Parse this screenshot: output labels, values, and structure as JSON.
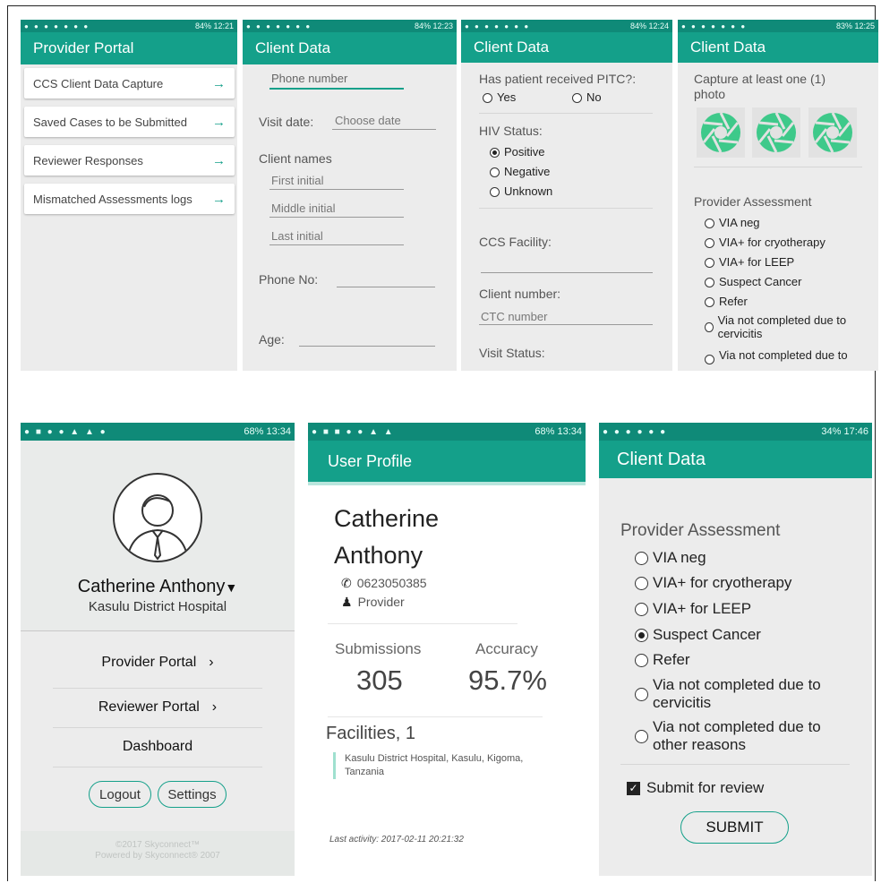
{
  "screen1": {
    "status": "84% 12:21",
    "title": "Provider Portal",
    "items": [
      "CCS Client Data Capture",
      "Saved Cases to be Submitted",
      "Reviewer Responses",
      "Mismatched Assessments logs"
    ]
  },
  "screen2": {
    "status": "84% 12:23",
    "title": "Client Data",
    "phone_placeholder": "Phone number",
    "visit_date_label": "Visit date:",
    "visit_date_placeholder": "Choose date",
    "client_names_label": "Client names",
    "first_initial": "First initial",
    "middle_initial": "Middle initial",
    "last_initial": "Last initial",
    "phone_no_label": "Phone No:",
    "age_label": "Age:"
  },
  "screen3": {
    "status": "84% 12:24",
    "title": "Client Data",
    "pitc_label": "Has patient received PITC?:",
    "yes": "Yes",
    "no": "No",
    "hiv_label": "HIV Status:",
    "hiv_options": [
      "Positive",
      "Negative",
      "Unknown"
    ],
    "hiv_selected": 0,
    "facility_label": "CCS Facility:",
    "client_number_label": "Client number:",
    "ctc_placeholder": "CTC number",
    "visit_status_label": "Visit Status:"
  },
  "screen4": {
    "status": "83% 12:25",
    "title": "Client Data",
    "photo_label": "Capture at least one (1) photo",
    "assessment_label": "Provider Assessment",
    "options": [
      "VIA neg",
      "VIA+ for cryotherapy",
      "VIA+ for LEEP",
      "Suspect Cancer",
      "Refer",
      "Via not completed due to cervicitis",
      "Via not completed due to"
    ]
  },
  "screen5": {
    "status": "68% 13:34",
    "name": "Catherine Anthony",
    "hospital": "Kasulu District Hospital",
    "menu": [
      "Provider Portal",
      "Reviewer Portal",
      "Dashboard"
    ],
    "logout": "Logout",
    "settings": "Settings",
    "footer1": "©2017 Skyconnect™",
    "footer2": "Powered by Skyconnect® 2007"
  },
  "screen6": {
    "status": "68% 13:34",
    "title": "User Profile",
    "first_name": "Catherine",
    "last_name": "Anthony",
    "phone": "0623050385",
    "role": "Provider",
    "submissions_label": "Submissions",
    "submissions_value": "305",
    "accuracy_label": "Accuracy",
    "accuracy_value": "95.7%",
    "facilities_label": "Facilities, 1",
    "facility_line1": "Kasulu District Hospital, Kasulu, Kigoma,",
    "facility_line2": "Tanzania",
    "last_activity": "Last activity: 2017-02-11 20:21:32"
  },
  "screen7": {
    "status": "34% 17:46",
    "title": "Client Data",
    "assessment_label": "Provider Assessment",
    "options": [
      "VIA neg",
      "VIA+ for cryotherapy",
      "VIA+ for LEEP",
      "Suspect Cancer",
      "Refer"
    ],
    "selected": 3,
    "opt_cervicitis_1": "Via not completed due to",
    "opt_cervicitis_2": "cervicitis",
    "opt_other_1": "Via not completed due to",
    "opt_other_2": "other reasons",
    "submit_review": "Submit for review",
    "submit": "SUBMIT"
  },
  "colors": {
    "teal_appbar": "#14a08a",
    "teal_status": "#0f8a78",
    "icon_green": "#3ec98a"
  }
}
